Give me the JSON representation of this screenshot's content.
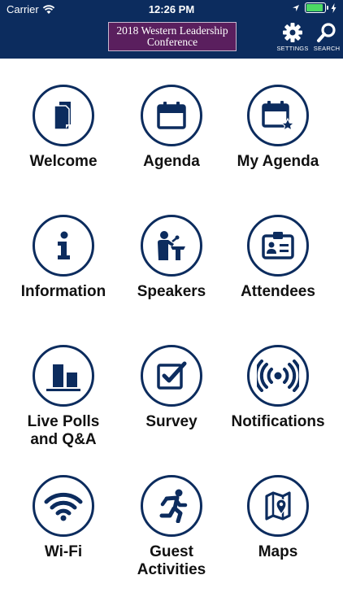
{
  "status_bar": {
    "carrier": "Carrier",
    "time": "12:26 PM"
  },
  "header": {
    "banner_line1": "2018 Western Leadership",
    "banner_line2": "Conference",
    "settings_label": "SETTINGS",
    "search_label": "SEARCH"
  },
  "colors": {
    "header_bg": "#0c2c5e",
    "icon_color": "#0c2c5e",
    "banner_bg": "#5a1f5e"
  },
  "tiles": [
    {
      "label": "Welcome",
      "icon": "document-icon"
    },
    {
      "label": "Agenda",
      "icon": "calendar-icon"
    },
    {
      "label": "My Agenda",
      "icon": "calendar-star-icon"
    },
    {
      "label": "Information",
      "icon": "info-icon"
    },
    {
      "label": "Speakers",
      "icon": "speaker-podium-icon"
    },
    {
      "label": "Attendees",
      "icon": "id-badge-icon"
    },
    {
      "label": "Live Polls and Q&A",
      "icon": "bar-chart-icon"
    },
    {
      "label": "Survey",
      "icon": "checkbox-icon"
    },
    {
      "label": "Notifications",
      "icon": "broadcast-icon"
    },
    {
      "label": "Wi-Fi",
      "icon": "wifi-icon"
    },
    {
      "label": "Guest Activities",
      "icon": "running-person-icon"
    },
    {
      "label": "Maps",
      "icon": "map-icon"
    }
  ]
}
